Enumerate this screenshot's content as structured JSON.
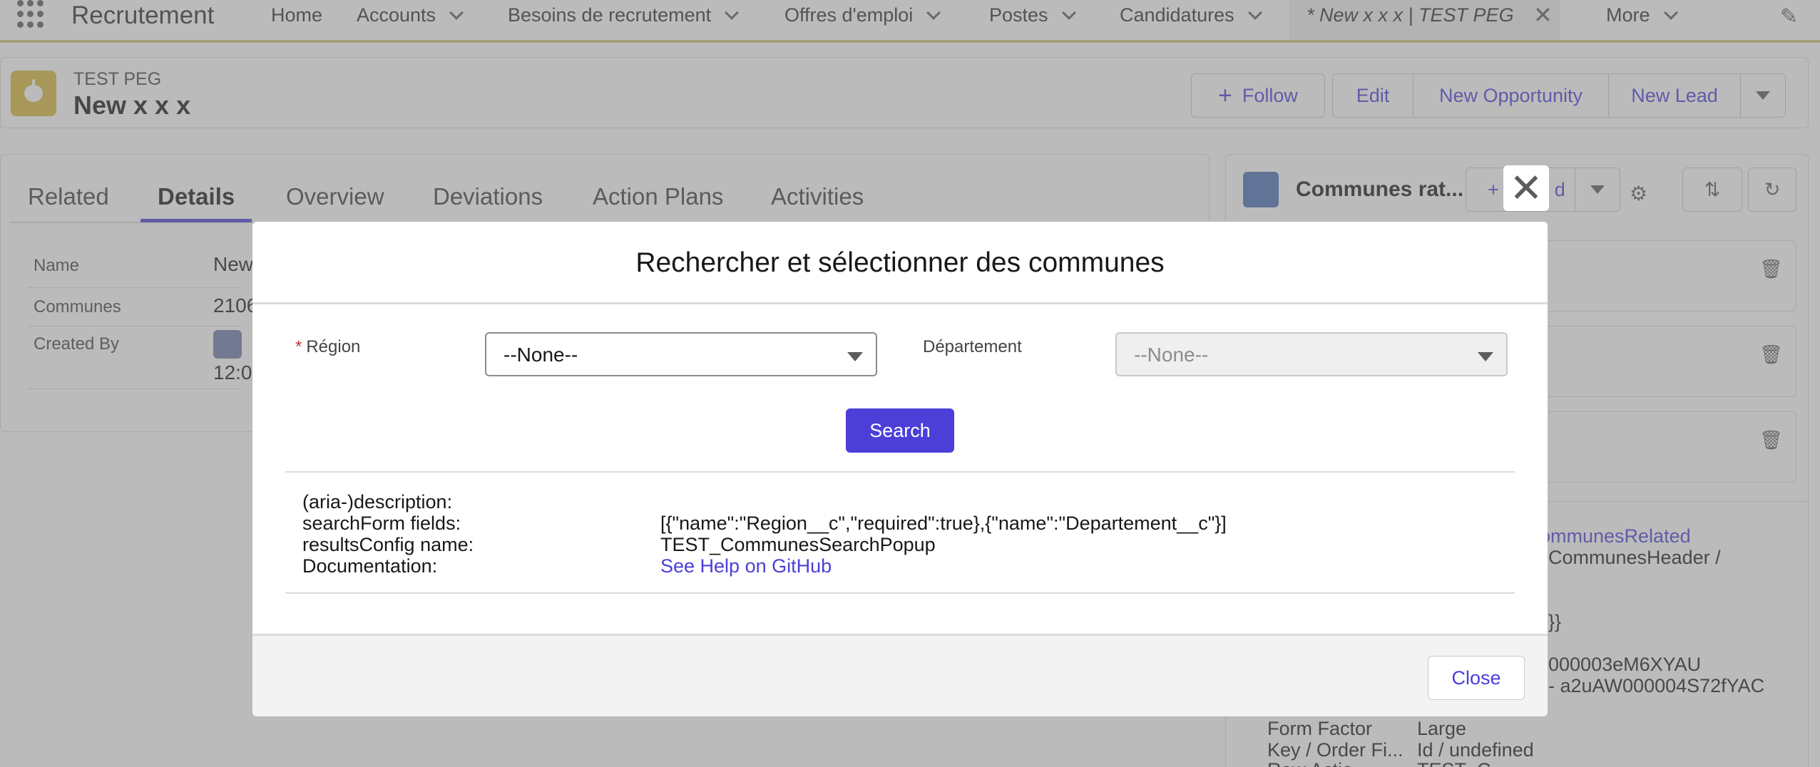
{
  "nav": {
    "app_name": "Recrutement",
    "items": [
      {
        "label": "Home"
      },
      {
        "label": "Accounts"
      },
      {
        "label": "Besoins de recrutement"
      },
      {
        "label": "Offres d'emploi"
      },
      {
        "label": "Postes"
      },
      {
        "label": "Candidatures"
      }
    ],
    "active_tab": "* New x x x | TEST PEG",
    "more_label": "More"
  },
  "record": {
    "object_label": "TEST PEG",
    "title": "New x x x",
    "buttons": {
      "follow": "Follow",
      "edit": "Edit",
      "new_opportunity": "New Opportunity",
      "new_lead": "New Lead"
    }
  },
  "tabs": [
    "Related",
    "Details",
    "Overview",
    "Deviations",
    "Action Plans",
    "Activities"
  ],
  "details": {
    "fields": [
      {
        "label": "Name",
        "value": "New"
      },
      {
        "label": "Communes",
        "value": "2106"
      },
      {
        "label": "Created By",
        "value": "12:0"
      }
    ]
  },
  "right_panel": {
    "title": "Communes rat...",
    "add_label": "+",
    "add_label_tail": "d",
    "text_lines": [
      "ommunesRelated",
      "CommunesHeader /",
      "}}",
      "000003eM6XYAU",
      "- a2uAW000004S72fYAC"
    ],
    "form_factor_label": "Form Factor",
    "form_factor_value": "Large",
    "key_order_label": "Key / Order Fi...",
    "key_order_value": "Id / undefined",
    "cutoff_label": "Row Actio...",
    "cutoff_value": "TEST_C..."
  },
  "modal": {
    "title": "Rechercher et sélectionner des communes",
    "region_label": "Région",
    "region_required_mark": "*",
    "region_value": "--None--",
    "departement_label": "Département",
    "departement_value": "--None--",
    "search_label": "Search",
    "info": [
      {
        "key": "(aria-)description:",
        "value": ""
      },
      {
        "key": "searchForm fields:",
        "value": "[{\"name\":\"Region__c\",\"required\":true},{\"name\":\"Departement__c\"}]"
      },
      {
        "key": "resultsConfig name:",
        "value": "TEST_CommunesSearchPopup"
      },
      {
        "key": "Documentation:",
        "value": "See Help on GitHub"
      }
    ],
    "close_label": "Close",
    "close_x": "✕"
  },
  "colors": {
    "brand": "#4b3fd8",
    "nav_underline": "#d4c47e",
    "record_icon": "#d6b73a",
    "required": "#c23934"
  }
}
